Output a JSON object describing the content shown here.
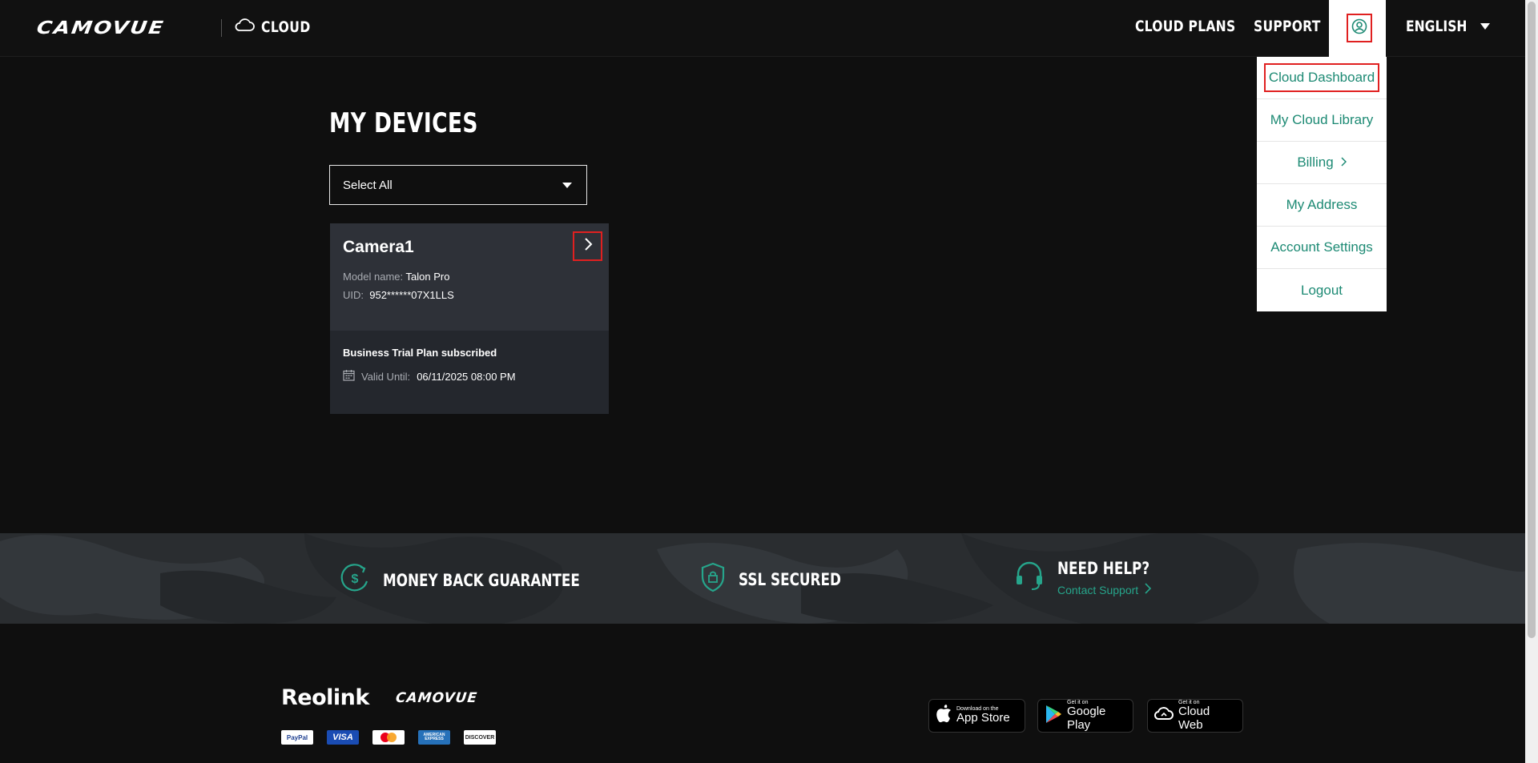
{
  "header": {
    "logo": "CAMOVUE",
    "cloud_label": "CLOUD",
    "nav": {
      "cloud_plans": "CLOUD PLANS",
      "support": "SUPPORT"
    },
    "language": "ENGLISH"
  },
  "account_menu": {
    "items": [
      {
        "label": "Cloud Dashboard"
      },
      {
        "label": "My Cloud Library"
      },
      {
        "label": "Billing"
      },
      {
        "label": "My Address"
      },
      {
        "label": "Account Settings"
      },
      {
        "label": "Logout"
      }
    ]
  },
  "main": {
    "title": "MY DEVICES",
    "device_filter": {
      "selected": "Select All"
    },
    "devices": [
      {
        "name": "Camera1",
        "model_label": "Model name:",
        "model": "Talon Pro",
        "uid_label": "UID:",
        "uid": "952******07X1LLS",
        "plan": "Business Trial Plan subscribed",
        "valid_label": "Valid Until:",
        "valid_until": "06/11/2025 08:00 PM"
      }
    ]
  },
  "features": {
    "money_back": "MONEY BACK GUARANTEE",
    "ssl": "SSL SECURED",
    "help_title": "NEED HELP?",
    "help_link": "Contact Support"
  },
  "footer": {
    "brand_reolink": "Reolink",
    "brand_camovue": "CAMOVUE",
    "payments": [
      "PayPal",
      "VISA",
      "",
      "AMERICAN EXPRESS",
      "DISCOVER"
    ],
    "stores": [
      {
        "small": "Download on the",
        "big": "App Store"
      },
      {
        "small": "Get it on",
        "big": "Google Play"
      },
      {
        "small": "Get it on",
        "big": "Cloud Web"
      }
    ]
  },
  "colors": {
    "accent_teal": "#1d8a74",
    "highlight_red": "#e02020",
    "background": "#0f0f0f",
    "card_top": "#2e3138",
    "card_bottom": "#24272d"
  }
}
